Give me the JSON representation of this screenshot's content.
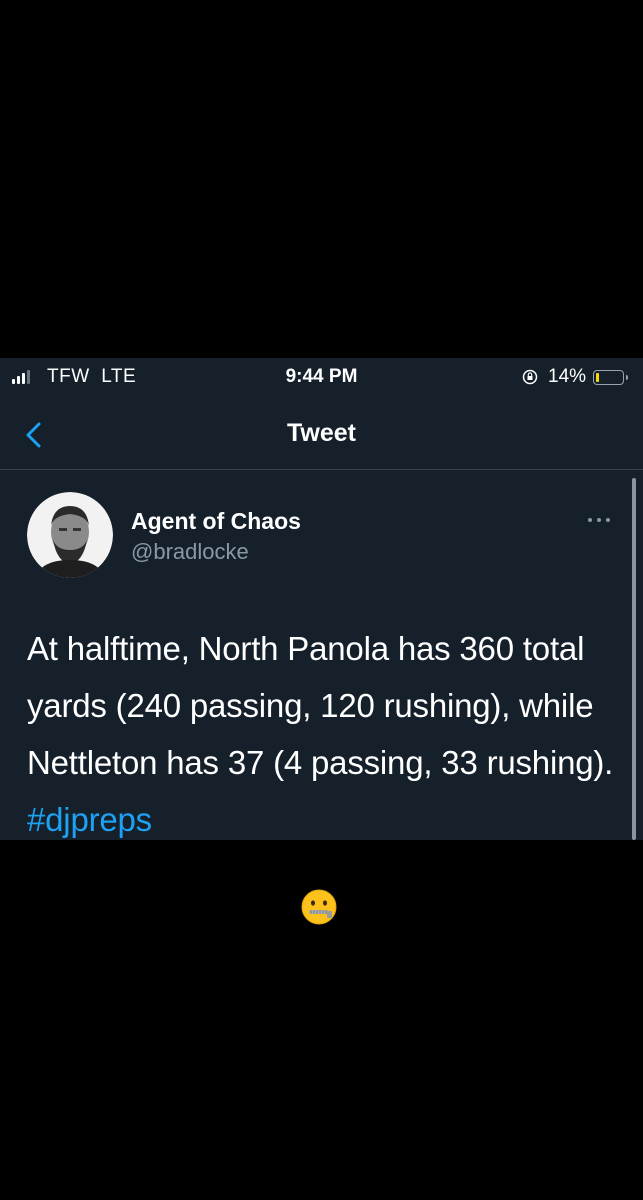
{
  "status_bar": {
    "carrier": "TFW  LTE",
    "time": "9:44 PM",
    "battery_percent": "14%",
    "battery_level": 0.14,
    "signal_bars": 3,
    "icons": [
      "signal-icon",
      "orientation-lock-icon",
      "battery-icon"
    ]
  },
  "nav": {
    "title": "Tweet",
    "back_icon": "chevron-left-icon"
  },
  "tweet": {
    "author_name": "Agent of Chaos",
    "author_handle": "@bradlocke",
    "text_before_hashtag": "At halftime, North Panola has 360 total yards (240 passing, 120 rushing), while Nettleton has 37 (4 passing, 33 rushing). ",
    "hashtag": "#djpreps",
    "more_icon": "ellipsis-icon"
  },
  "colors": {
    "background": "#15202b",
    "accent": "#1da1f2",
    "secondary_text": "#8899a6",
    "battery_low": "#f5d90a"
  },
  "overlay": {
    "emoji_icon": "zipper-mouth-face-icon"
  }
}
